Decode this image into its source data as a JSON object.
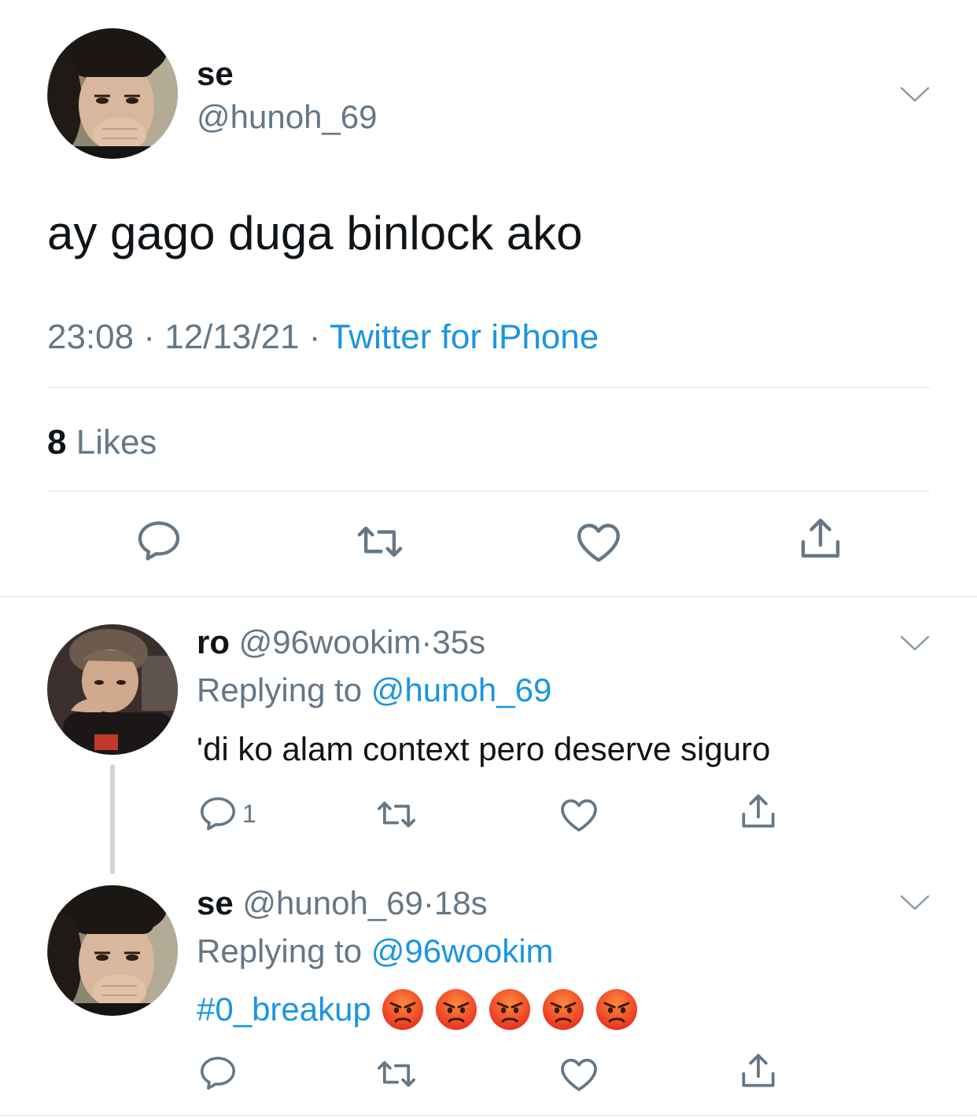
{
  "main_tweet": {
    "display_name": "se",
    "handle": "@hunoh_69",
    "text": "ay gago duga binlock ako",
    "time": "23:08",
    "separator": "·",
    "date": "12/13/21",
    "source": "Twitter for iPhone",
    "likes_count": "8",
    "likes_label": "Likes"
  },
  "reply1": {
    "display_name": "ro",
    "handle": "@96wookim",
    "separator": "·",
    "age": "35s",
    "replying_prefix": "Replying to",
    "replying_handle": "@hunoh_69",
    "text": "'di ko alam context pero deserve siguro",
    "reply_count": "1"
  },
  "reply2": {
    "display_name": "se",
    "handle": "@hunoh_69",
    "separator": "·",
    "age": "18s",
    "replying_prefix": "Replying to",
    "replying_handle": "@96wookim",
    "hashtag": "#0_breakup",
    "emojis": [
      "angry-face-emoji",
      "angry-face-emoji",
      "angry-face-emoji",
      "angry-face-emoji",
      "angry-face-emoji"
    ]
  },
  "icons": {
    "reply": "reply-icon",
    "retweet": "retweet-icon",
    "like": "heart-icon",
    "share": "share-icon",
    "more": "chevron-down-icon"
  },
  "colors": {
    "text": "#0f1419",
    "secondary": "#657786",
    "link": "#1b95e0",
    "divider": "#dfe3e6",
    "thread_line": "#ccd6dd"
  }
}
